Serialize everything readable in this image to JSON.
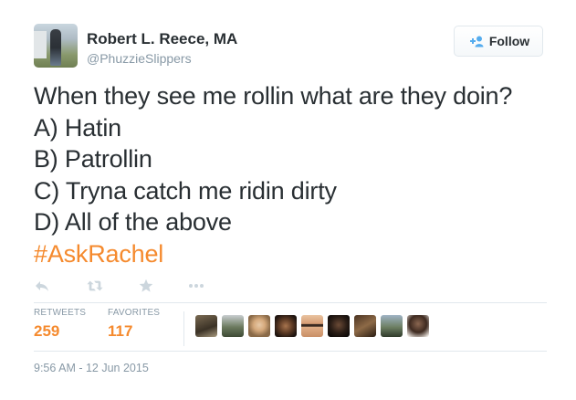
{
  "user": {
    "full_name": "Robert L. Reece, MA",
    "username": "@PhuzzieSlippers"
  },
  "follow_button": {
    "label": "Follow",
    "icon": "add-user-icon"
  },
  "tweet": {
    "lines": [
      "When they see me rollin what are they doin?",
      "A) Hatin",
      "B) Patrollin",
      "C) Tryna catch me ridin dirty",
      "D) All of the above"
    ],
    "hashtag": "#AskRachel"
  },
  "actions": {
    "reply_icon": "reply-icon",
    "retweet_icon": "retweet-icon",
    "favorite_icon": "star-icon",
    "more_icon": "more-dots-icon"
  },
  "stats": {
    "retweets": {
      "label": "RETWEETS",
      "value": "259"
    },
    "favorites": {
      "label": "FAVORITES",
      "value": "117"
    }
  },
  "favorited_by_count": 9,
  "timestamp": "9:56 AM - 12 Jun 2015",
  "colors": {
    "accent": "#f58a2e",
    "text": "#292f33",
    "muted": "#8899a6",
    "border": "#e1e8ed",
    "icon": "#ccd6dd"
  }
}
